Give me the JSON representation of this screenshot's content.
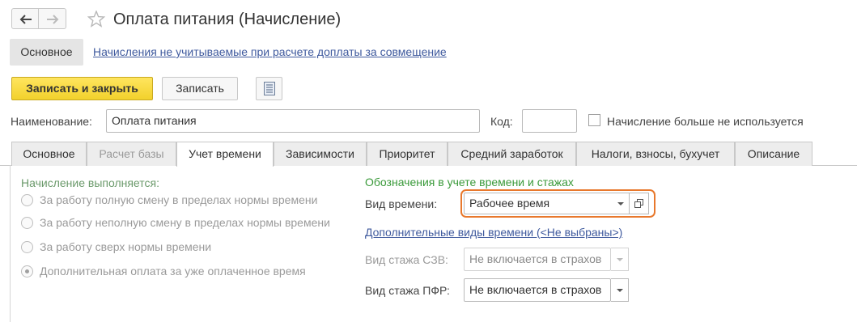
{
  "window": {
    "title": "Оплата питания (Начисление)"
  },
  "sections": {
    "main": "Основное",
    "link": "Начисления не учитываемые при расчете доплаты за совмещение"
  },
  "toolbar": {
    "save_close": "Записать и закрыть",
    "save": "Записать"
  },
  "form": {
    "name_label": "Наименование:",
    "name_value": "Оплата питания",
    "code_label": "Код:",
    "code_value": "",
    "unused_label": "Начисление больше не используется",
    "unused_checked": false
  },
  "tabs": [
    {
      "label": "Основное"
    },
    {
      "label": "Расчет базы"
    },
    {
      "label": "Учет времени"
    },
    {
      "label": "Зависимости"
    },
    {
      "label": "Приоритет"
    },
    {
      "label": "Средний заработок"
    },
    {
      "label": "Налоги, взносы, бухучет"
    },
    {
      "label": "Описание"
    }
  ],
  "accrual": {
    "title": "Начисление выполняется:",
    "options": [
      {
        "label": "За работу полную смену в пределах нормы времени",
        "checked": false
      },
      {
        "label": "За работу неполную смену в пределах нормы времени",
        "checked": false
      },
      {
        "label": "За работу сверх нормы времени",
        "checked": false
      },
      {
        "label": "Дополнительная оплата за уже оплаченное время",
        "checked": true
      }
    ]
  },
  "designations": {
    "title": "Обозначения в учете времени и стажах",
    "time_type_label": "Вид времени:",
    "time_type_value": "Рабочее время",
    "additional_link": "Дополнительные виды времени (<Не выбраны>)",
    "szv_label": "Вид стажа СЗВ:",
    "szv_value": "Не включается в страхов",
    "pfr_label": "Вид стажа ПФР:",
    "pfr_value": "Не включается в страхов"
  },
  "colors": {
    "primary_button": "#f2d12c",
    "highlight": "#e8782c",
    "link": "#3f5a9e",
    "group_title": "#3a9a3a"
  }
}
